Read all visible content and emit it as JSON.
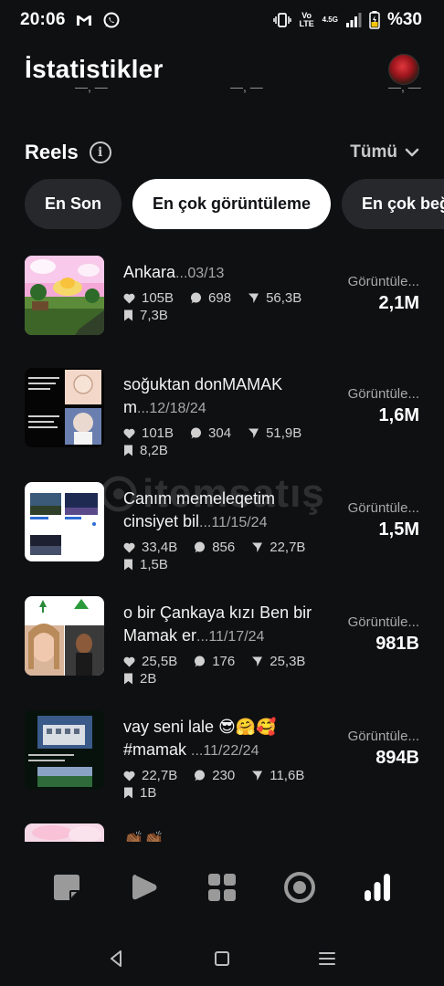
{
  "status": {
    "time": "20:06",
    "lte": "Vo LTE",
    "net": "4.5G",
    "battery": "%30"
  },
  "header": {
    "title": "İstatistikler"
  },
  "section": {
    "title": "Reels",
    "info": "i",
    "filter": "Tümü"
  },
  "chips": [
    "En Son",
    "En çok görüntüleme",
    "En çok beğe"
  ],
  "watermark": "itemsatış",
  "reels": [
    {
      "title": "Ankara",
      "date": "...03/13",
      "likes": "105B",
      "comments": "698",
      "shares": "56,3B",
      "saves": "7,3B",
      "views_label": "Görüntüle...",
      "views": "2,1M"
    },
    {
      "title": "soğuktan donMAMAK m",
      "date": "...12/18/24",
      "likes": "101B",
      "comments": "304",
      "shares": "51,9B",
      "saves": "8,2B",
      "views_label": "Görüntüle...",
      "views": "1,6M"
    },
    {
      "title": "Canım memeleqetim cinsiyet bil",
      "date": "...11/15/24",
      "likes": "33,4B",
      "comments": "856",
      "shares": "22,7B",
      "saves": "1,5B",
      "views_label": "Görüntüle...",
      "views": "1,5M"
    },
    {
      "title": "o bir Çankaya kızı Ben bir Mamak er",
      "date": "...11/17/24",
      "likes": "25,5B",
      "comments": "176",
      "shares": "25,3B",
      "saves": "2B",
      "views_label": "Görüntüle...",
      "views": "981B"
    },
    {
      "title": "vay seni lale 😎🤗🥰 #mamak ",
      "date": "...11/22/24",
      "likes": "22,7B",
      "comments": "230",
      "shares": "11,6B",
      "saves": "1B",
      "views_label": "Görüntüle...",
      "views": "894B"
    },
    {
      "title": "👏🏾👏🏾"
    }
  ],
  "thumbs": {
    "t2": {
      "left": "Çanakkale'den yapıldı",
      "right": ""
    },
    "t3": {
      "a": "Keçiören",
      "b": "Mamak",
      "c": "Etimesgut"
    },
    "t4": {
      "a": "Çankaya",
      "b": "MAMAK",
      "c": "kızı",
      "d": "erkeği"
    }
  },
  "nav": [
    "notes-icon",
    "play-icon",
    "grid-icon",
    "record-icon",
    "stats-icon"
  ]
}
